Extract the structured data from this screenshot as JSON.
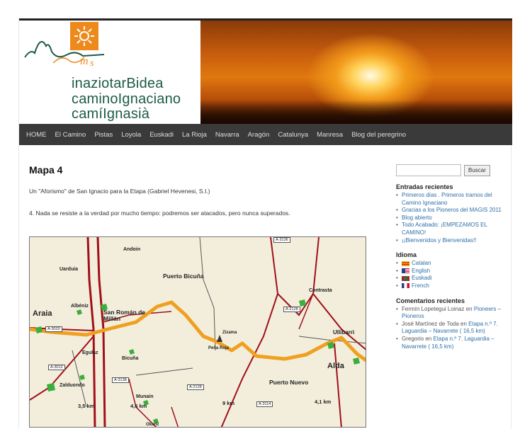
{
  "header": {
    "logo_lines": [
      "inaziotarBidea",
      "caminoIgnaciano",
      "camíIgnasià"
    ],
    "colors": {
      "logo_green": "#1d5b45",
      "sun_orange": "#ee8a1c"
    }
  },
  "nav": {
    "items": [
      "HOME",
      "El Camino",
      "Pistas",
      "Loyola",
      "Euskadi",
      "La Rioja",
      "Navarra",
      "Aragón",
      "Catalunya",
      "Manresa",
      "Blog del peregrino"
    ]
  },
  "main": {
    "title": "Mapa 4",
    "paragraph_1": "Un \"Aforismo\" de San Ignacio para la Etapa (Gabriel Hevenesi, S.I.)",
    "paragraph_2": "4. Nada se resiste a la verdad por mucho tiempo: podremos ser atacados, pero nunca superados."
  },
  "map": {
    "places": {
      "andoin": "Andoin",
      "uarduia": "Uarduia",
      "albeniz": "Albéniz",
      "araia": "Araia",
      "san_roman": "San Román de Millán",
      "puerto_bicuna": "Puerto Bicuña",
      "contrasta": "Contrasta",
      "ullibarri": "Ullibarri",
      "alda": "Alda",
      "egunilaz": "Egulaz",
      "bicuna": "Bicuña",
      "pena_roja": "Peña Roja",
      "zizama": "Zizama",
      "zalduondo": "Zalduondo",
      "munain": "Munain",
      "okariz": "Okariz",
      "puerto_nuevo": "Puerto Nuevo"
    },
    "roads": [
      "A-2128",
      "A-2128",
      "A-3020",
      "A-3012",
      "A-3138",
      "A-2128",
      "A-3114",
      "A-3136"
    ],
    "distances": [
      "3,5 km",
      "4,6 km",
      "9 km",
      "4,1 km"
    ],
    "colors": {
      "route": "#f0a020",
      "village": "#3cae3c",
      "road": "#a0101a"
    }
  },
  "sidebar": {
    "search_button": "Buscar",
    "recent_title": "Entradas recientes",
    "recent": [
      "Primeros días . Primeros tramos del Camino Ignaciano",
      "Gracias a los Pioneros del MAGIS 2011",
      "Blog abierto",
      "Todo Acabado: ¡EMPEZAMOS EL CAMINO!",
      "¡¡Bienvenidos y Bienvenidas!!"
    ],
    "lang_title": "Idioma",
    "languages": [
      "Catalan",
      "English",
      "Euskadi",
      "French"
    ],
    "comments_title": "Comentarios recientes",
    "comments": [
      {
        "author": "Fermín Lopetegui Loinaz en",
        "post": "Pioneers – Pioneros"
      },
      {
        "author": "José Martínez de Toda en",
        "post": "Etapa n.º 7. Laguardia – Navarrete ( 16,5 km)"
      },
      {
        "author": "Gregorio en",
        "post": "Etapa n.º 7. Laguardia – Navarrete ( 16,5 km)"
      }
    ]
  }
}
